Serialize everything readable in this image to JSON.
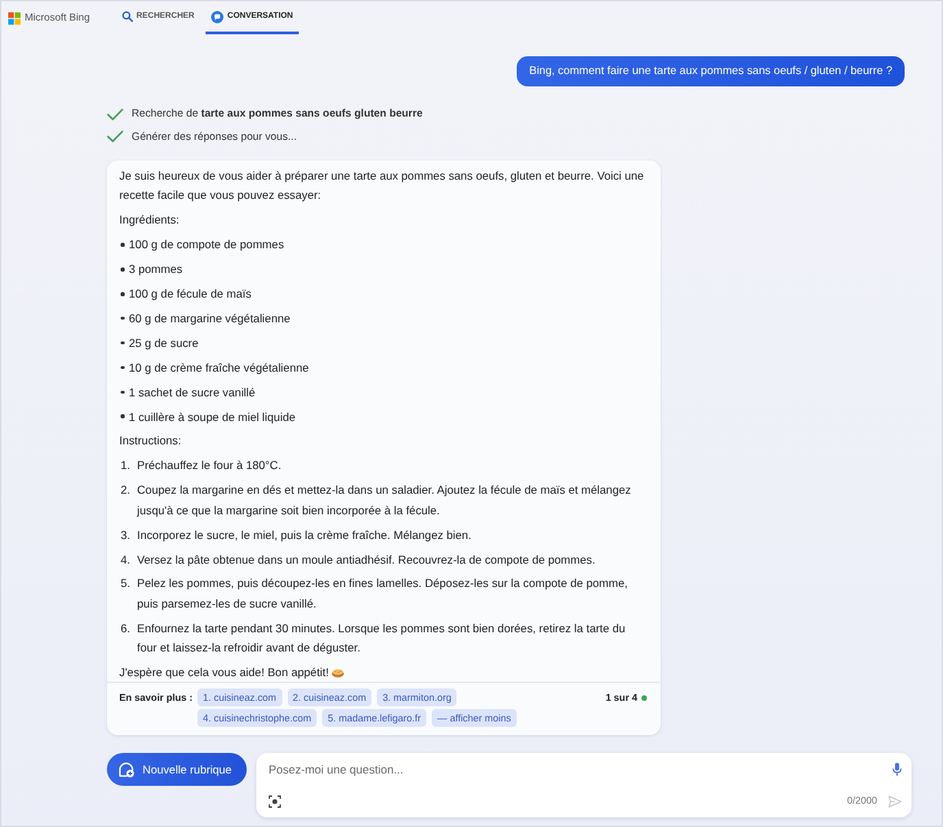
{
  "header": {
    "logo_text": "Microsoft Bing",
    "tabs": [
      {
        "label": "RECHERCHER",
        "selected": false
      },
      {
        "label": "CONVERSATION",
        "selected": true
      }
    ]
  },
  "user_message": "Bing, comment faire une tarte aux pommes sans oeufs / gluten / beurre ?",
  "progress": [
    {
      "text": "Recherche de **tarte aux pommes sans oeufs gluten beurre**"
    },
    {
      "text": "Générer des réponses pour vous..."
    }
  ],
  "response": {
    "intro": "Je suis heureux de vous aider à préparer une tarte aux pommes sans oeufs, gluten et beurre. Voici une recette facile que vous pouvez essayer:",
    "ingredients_heading": "Ingrédients:",
    "ingredients": [
      "100 g de compote de pommes",
      "3 pommes",
      "100 g de fécule de maïs",
      "60 g de margarine végétalienne",
      "25 g de sucre",
      "10 g de crème fraîche végétalienne",
      "1 sachet de sucre vanillé",
      "1 cuillère à soupe de miel liquide"
    ],
    "instructions_heading": "Instructions:",
    "instructions": [
      {
        "number": "1.",
        "text": "Préchauffez le four à 180°C."
      },
      {
        "number": "2.",
        "text": "Coupez la margarine en dés et mettez-la dans un saladier. Ajoutez la fécule de maïs et mélangez jusqu'à ce que la margarine soit bien incorporée à la fécule."
      },
      {
        "number": "3.",
        "text": "Incorporez le sucre, le miel, puis la crème fraîche. Mélangez bien."
      },
      {
        "number": "4.",
        "text": "Versez la pâte obtenue dans un moule antiadhésif. Recouvrez-la de compote de pommes."
      },
      {
        "number": "5.",
        "text": "Pelez les pommes, puis découpez-les en fines lamelles. Déposez-les sur la compote de pomme, puis parsemez-les de sucre vanillé."
      },
      {
        "number": "6.",
        "text": "Enfournez la tarte pendant 30 minutes. Lorsque les pommes sont bien dorées, retirez la tarte du four et laissez-la refroidir avant de déguster."
      }
    ],
    "closing": "J'espère que cela vous aide! Bon appétit!"
  },
  "sources": {
    "label": "En savoir plus :",
    "links": [
      "1. cuisineaz.com",
      "2. cuisineaz.com",
      "3. marmiton.org",
      "4. cuisinechristophe.com",
      "5. madame.lefigaro.fr"
    ],
    "toggle": "— afficher moins",
    "counter": "1 sur 4"
  },
  "composer": {
    "new_topic_button": "Nouvelle rubrique",
    "placeholder": "Posez-moi une question...",
    "char_count": "0/2000",
    "send_button": {
      "disabled": true
    }
  }
}
